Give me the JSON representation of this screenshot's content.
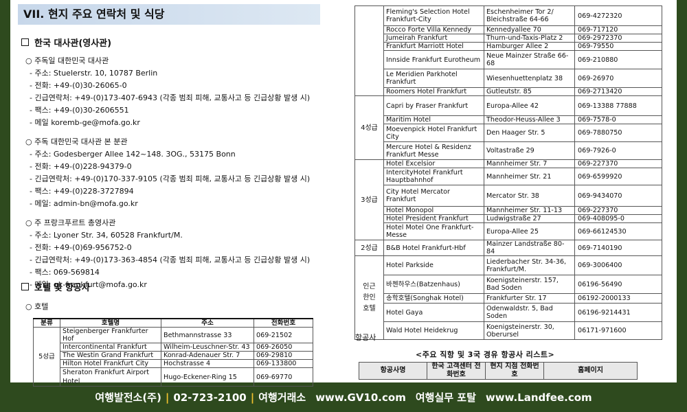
{
  "title": "VII. 현지 주요 연락처 및 식당",
  "section1": "한국 대사관(영사관)",
  "embassies": [
    {
      "name": "○ 주독일 대한민국 대사관",
      "lines": [
        "- 주소: Stuelerstr. 10, 10787 Berlin",
        "- 전화: +49-(0)30-26065-0",
        "- 긴급연락처: +49-(0)173-407-6943 (각종 범죄 피해, 교통사고 등 긴급상황 발생 시)",
        "- 팩스: +49-(0)30-2606551",
        "- 메일 koremb-ge@mofa.go.kr"
      ]
    },
    {
      "name": "○ 주독 대한민국 대사관 본 분관",
      "lines": [
        "- 주소: Godesberger Allee 142~148. 3OG., 53175 Bonn",
        "- 전화: +49-(0)228-94379-0",
        "- 긴급연락처: +49-(0)170-337-9105 (각종 범죄 피해, 교통사고 등 긴급상황 발생 시)",
        "- 팩스: +49-(0)228-3727894",
        "- 메일: admin-bn@mofa.go.kr"
      ]
    },
    {
      "name": "○ 주 프랑크푸르트 총영사관",
      "lines": [
        "- 주소: Lyoner Str. 34, 60528 Frankfurt/M.",
        "- 전화: +49-(0)69-956752-0",
        "- 긴급연락처: +49-(0)173-363-4854 (각종 범죄 피해, 교통사고 등 긴급상황 발생 시)",
        "- 팩스: 069-569814",
        "- 메일: gk-frankfurt@mofa.go.kr"
      ]
    }
  ],
  "section2": "호텔 및 항공사",
  "hotel_sub": "○ 호텔",
  "hotel_headers": [
    "분류",
    "호텔명",
    "주소",
    "전화번호"
  ],
  "hotel_grade_5": "5성급",
  "hotels_left": [
    {
      "name": "Steigenberger Frankfurter Hof",
      "addr": "Bethmannstrasse 33",
      "tel": "069-21502"
    },
    {
      "name": "Intercontinental Frankfurt",
      "addr": "Wilheim-Leuschner-Str. 43",
      "tel": "069-26050"
    },
    {
      "name": "The Westin Grand Frankfurt",
      "addr": "Konrad-Adenauer Str. 7",
      "tel": "069-29810"
    },
    {
      "name": "Hilton Hotel Frankfurt City",
      "addr": "Hochstrasse 4",
      "tel": "069-133800"
    },
    {
      "name": "Sheraton Frankfurt Airport Hotel",
      "addr": "Hugo-Eckener-Ring 15",
      "tel": "069-69770"
    }
  ],
  "right_groups": [
    {
      "grade": "",
      "rows": [
        {
          "name": "Fleming's Selection Hotel Frankfurt-City",
          "addr": "Eschenheimer Tor 2/ Bleichstraße 64-66",
          "tel": "069-4272320"
        },
        {
          "name": "Rocco Forte Villa Kennedy",
          "addr": "Kennedyallee 70",
          "tel": "069-717120"
        },
        {
          "name": "Jumeirah Frankfurt",
          "addr": "Thurn-und-Taxis-Platz 2",
          "tel": "069-2972370"
        },
        {
          "name": "Frankfurt Marriott Hotel",
          "addr": "Hamburger Allee 2",
          "tel": "069-79550"
        },
        {
          "name": "Innside Frankfurt Eurotheum",
          "addr": "Neue Mainzer Straße 66-68",
          "tel": "069-210880"
        },
        {
          "name": "Le Meridien Parkhotel Frankfurt",
          "addr": "Wiesenhuettenplatz 38",
          "tel": "069-26970"
        },
        {
          "name": "Roomers Hotel Frankfurt",
          "addr": "Gutleutstr. 85",
          "tel": "069-2713420"
        }
      ]
    },
    {
      "grade": "4성급",
      "rows": [
        {
          "name": "Capri by Fraser Frankfurt",
          "addr": "Europa-Allee 42",
          "tel": "069-13388 77888"
        },
        {
          "name": "Maritim Hotel",
          "addr": "Theodor-Heuss-Allee 3",
          "tel": "069-7578-0"
        },
        {
          "name": "Moevenpick Hotel Frankfurt City",
          "addr": "Den Haager Str. 5",
          "tel": "069-7880750"
        },
        {
          "name": "Mercure Hotel & Residenz Frankfurt Messe",
          "addr": "Voltastraße 29",
          "tel": "069-7926-0"
        }
      ]
    },
    {
      "grade": "3성급",
      "rows": [
        {
          "name": "Hotel Excelsior",
          "addr": "Mannheimer Str. 7",
          "tel": "069-227370"
        },
        {
          "name": "IntercityHotel Frankfurt Hauptbahnhof",
          "addr": "Mannheimer Str. 21",
          "tel": "069-6599920"
        },
        {
          "name": "City Hotel Mercator Frankfurt",
          "addr": "Mercator Str. 38",
          "tel": "069-9434070"
        },
        {
          "name": "Hotel Monopol",
          "addr": "Mannheimer Str. 11-13",
          "tel": "069-227370"
        },
        {
          "name": "Hotel President Frankfurt",
          "addr": "Ludwigstraße 27",
          "tel": "069-408095-0"
        },
        {
          "name": "Hotel Motel One Frankfurt-Messe",
          "addr": "Europa-Allee 25",
          "tel": "069-66124530"
        }
      ]
    },
    {
      "grade": "2성급",
      "rows": [
        {
          "name": "B&B Hotel Frankfurt-Hbf",
          "addr": "Mainzer Landstraße 80-84",
          "tel": "069-7140190"
        }
      ]
    },
    {
      "grade": "인근 한인 호텔",
      "rows": [
        {
          "name": "Hotel Parkside",
          "addr": "Liederbacher Str. 34-36, Frankfurt/M.",
          "tel": "069-3006400"
        },
        {
          "name": "바첸하우스(Batzenhaus)",
          "addr": "Koenigsteinerstr. 157, Bad Soden",
          "tel": "06196-56490"
        },
        {
          "name": "송학호텔(Songhak Hotel)",
          "addr": "Frankfurter Str. 17",
          "tel": "06192-2000133"
        },
        {
          "name": "Hotel Gaya",
          "addr": "Odenwaldstr. 5, Bad Soden",
          "tel": "06196-9214431"
        },
        {
          "name": "Wald Hotel Heidekrug",
          "addr": "Koenigsteinerstr. 30, Oberursel",
          "tel": "06171-971600"
        }
      ]
    }
  ],
  "airline_label": "항공사",
  "airline_title": "<주요 직항 및 3국 경유 항공사 리스트>",
  "airline_headers": [
    "항공사명",
    "한국 고객센터 전화번호",
    "현지 지점 전화번호",
    "홈페이지"
  ],
  "footer": {
    "company": "여행발전소(주)",
    "phone": "02-723-2100",
    "name2": "여행거래소",
    "site1": "www.GV10.com",
    "name3": "여행실무 포탈",
    "site2": "www.Landfee.com"
  }
}
